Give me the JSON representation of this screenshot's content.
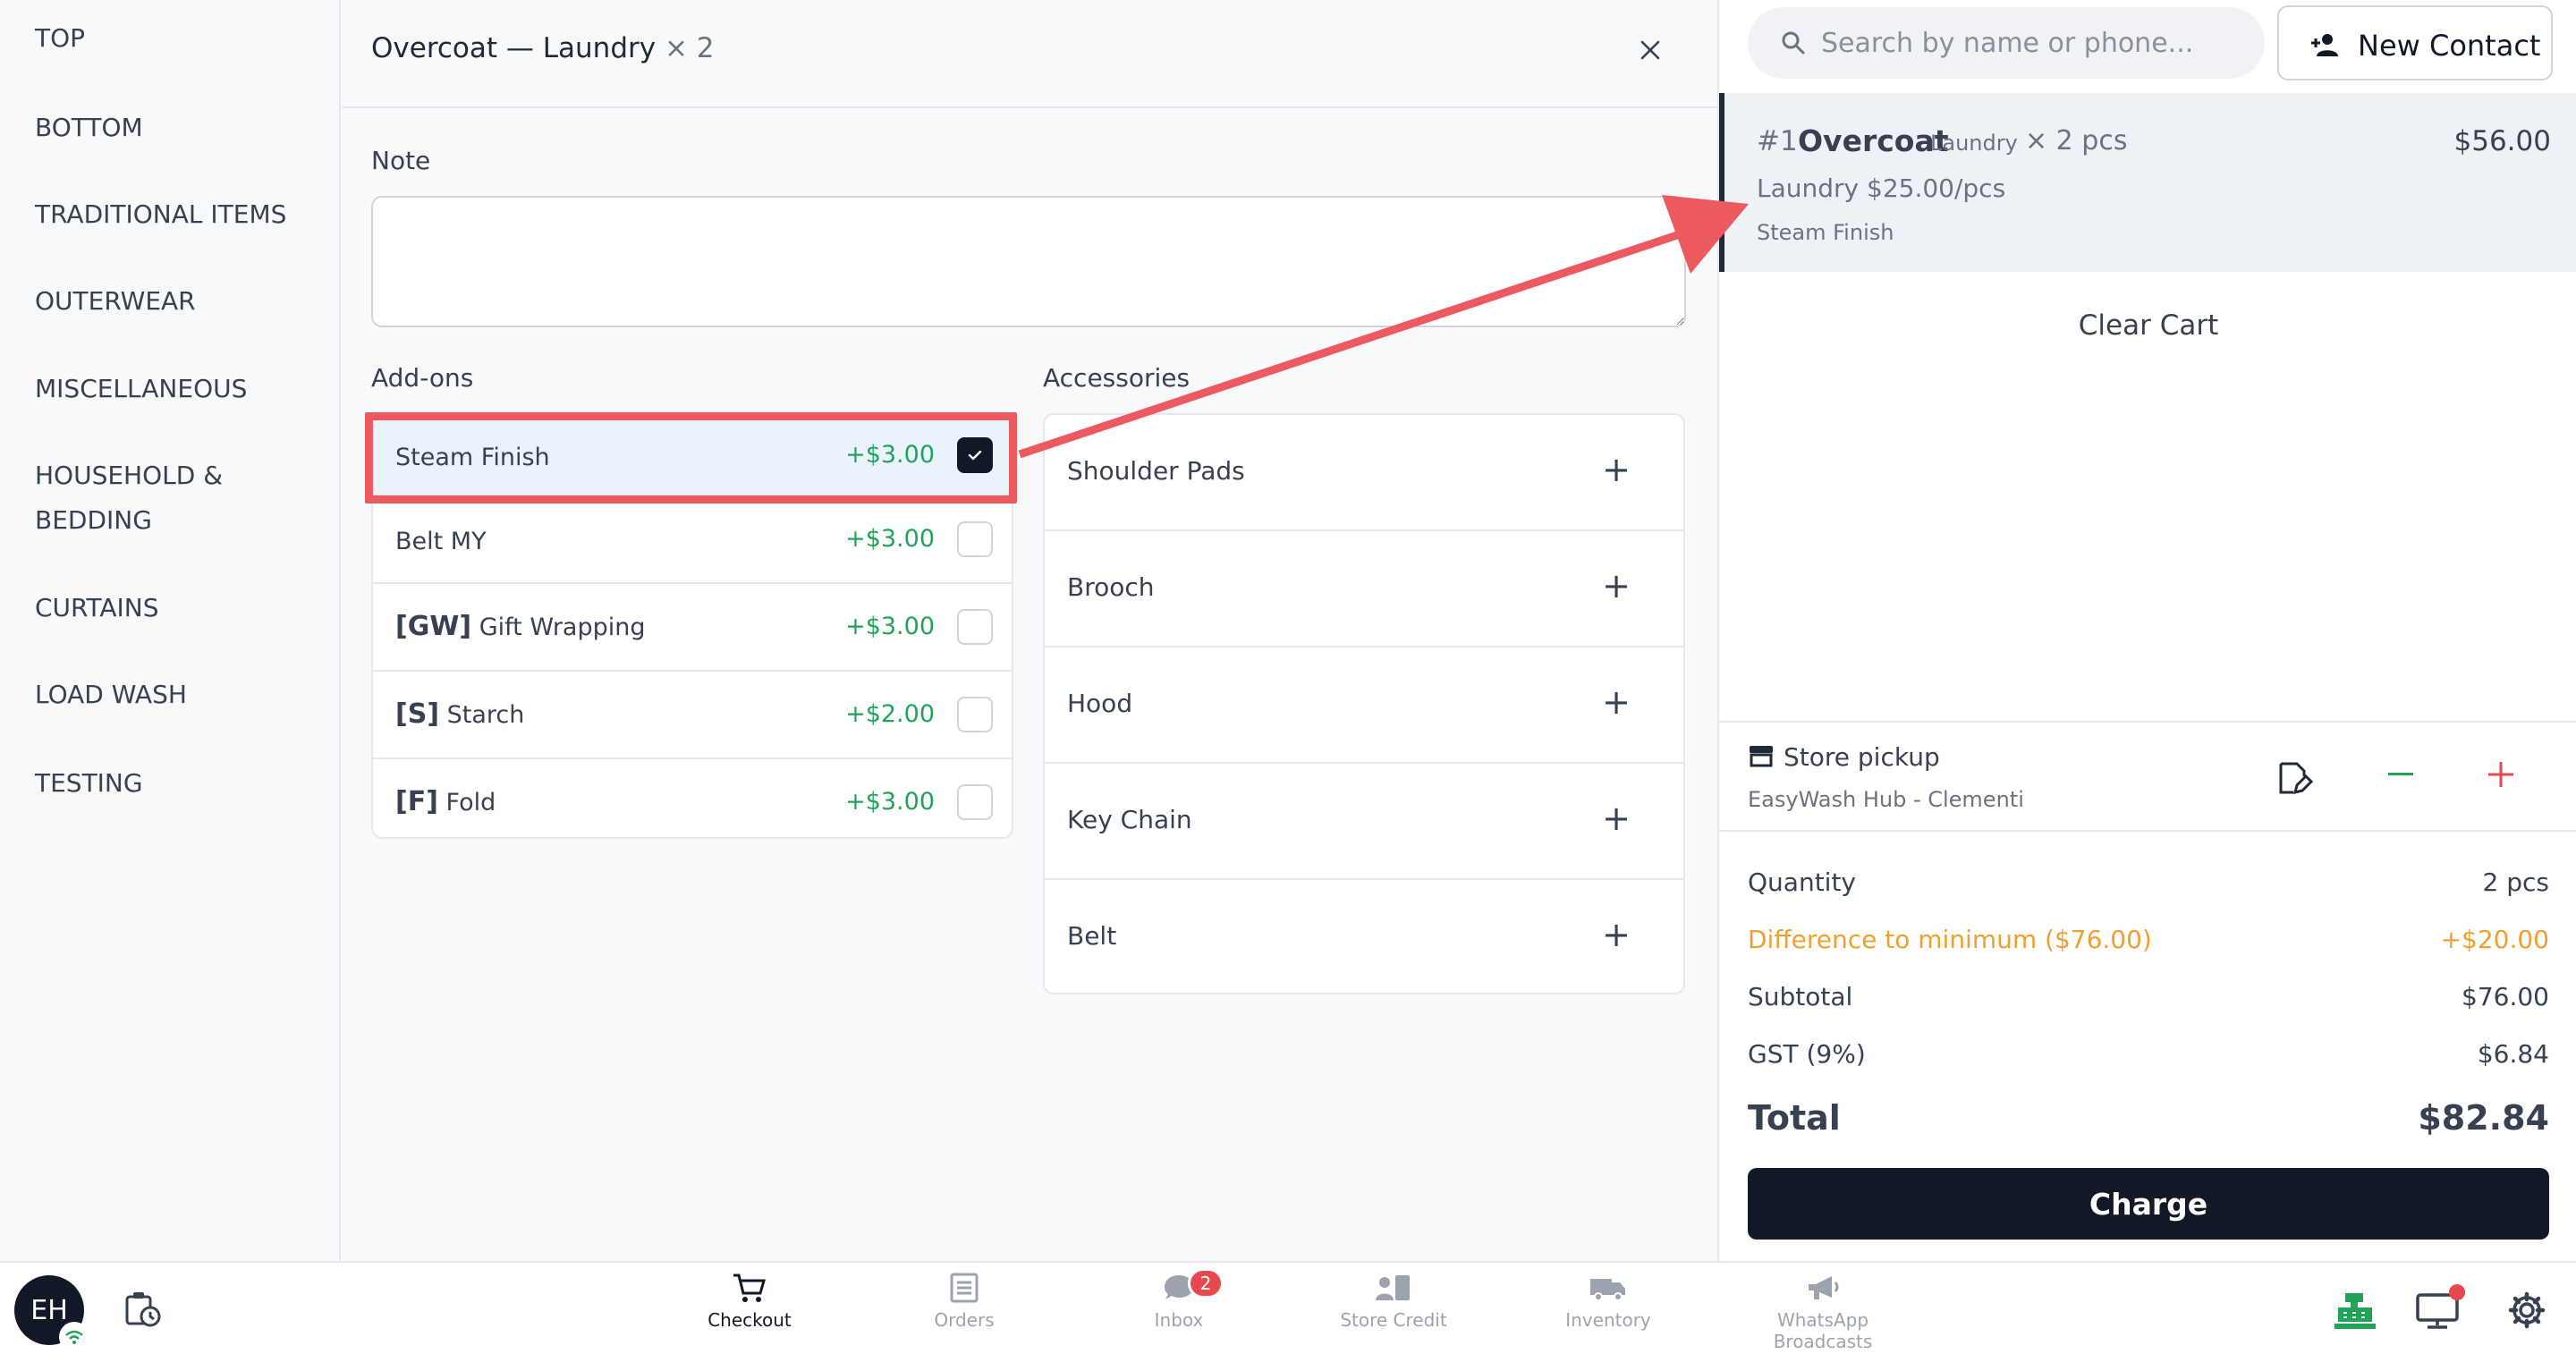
{
  "sidebar": {
    "categories": [
      "TOP",
      "BOTTOM",
      "TRADITIONAL ITEMS",
      "OUTERWEAR",
      "MISCELLANEOUS",
      "HOUSEHOLD &",
      "BEDDING",
      "CURTAINS",
      "LOAD WASH",
      "TESTING"
    ]
  },
  "editor": {
    "title_item": "Overcoat — Laundry",
    "title_qty": " × 2",
    "note_label": "Note",
    "note_value": "",
    "addons_label": "Add-ons",
    "addons": [
      {
        "code": "",
        "name": "Steam Finish",
        "price": "+$3.00",
        "checked": true
      },
      {
        "code": "",
        "name": "Belt MY",
        "price": "+$3.00",
        "checked": false
      },
      {
        "code": "[GW]",
        "name": " Gift Wrapping",
        "price": "+$3.00",
        "checked": false
      },
      {
        "code": "[S]",
        "name": " Starch",
        "price": "+$2.00",
        "checked": false
      },
      {
        "code": "[F]",
        "name": " Fold",
        "price": "+$3.00",
        "checked": false
      }
    ],
    "accessories_label": "Accessories",
    "accessories": [
      "Shoulder Pads",
      "Brooch",
      "Hood",
      "Key Chain",
      "Belt"
    ]
  },
  "search": {
    "placeholder": "Search by name or phone..."
  },
  "new_contact_label": "New Contact",
  "cart": {
    "line": {
      "index": "#1",
      "name": "Overcoat",
      "service": "Laundry",
      "qty": "× 2 pcs",
      "total": "$56.00",
      "rate": "Laundry $25.00/pcs",
      "addon": "Steam Finish"
    },
    "clear_label": "Clear Cart",
    "pickup": {
      "title": "Store pickup",
      "location": "EasyWash Hub - Clementi"
    },
    "summary": {
      "quantity_label": "Quantity",
      "quantity_value": "2 pcs",
      "diff_label": "Difference to minimum ($76.00)",
      "diff_value": "+$20.00",
      "subtotal_label": "Subtotal",
      "subtotal_value": "$76.00",
      "gst_label": "GST (9%)",
      "gst_value": "$6.84",
      "total_label": "Total",
      "total_value": "$82.84"
    },
    "charge_label": "Charge"
  },
  "bottom_nav": {
    "avatar_initials": "EH",
    "items": [
      {
        "label": "Checkout",
        "icon": "cart-icon"
      },
      {
        "label": "Orders",
        "icon": "orders-icon"
      },
      {
        "label": "Inbox",
        "icon": "inbox-icon",
        "badge": "2"
      },
      {
        "label": "Store Credit",
        "icon": "store-credit-icon"
      },
      {
        "label": "Inventory",
        "icon": "truck-icon"
      },
      {
        "label": "WhatsApp Broadcasts",
        "icon": "megaphone-icon"
      }
    ]
  },
  "colors": {
    "accent_dark": "#111827",
    "price_green": "#22a35a",
    "warning_orange": "#f0a030",
    "annotation_red": "#ec5a60",
    "badge_red": "#e5484d"
  }
}
